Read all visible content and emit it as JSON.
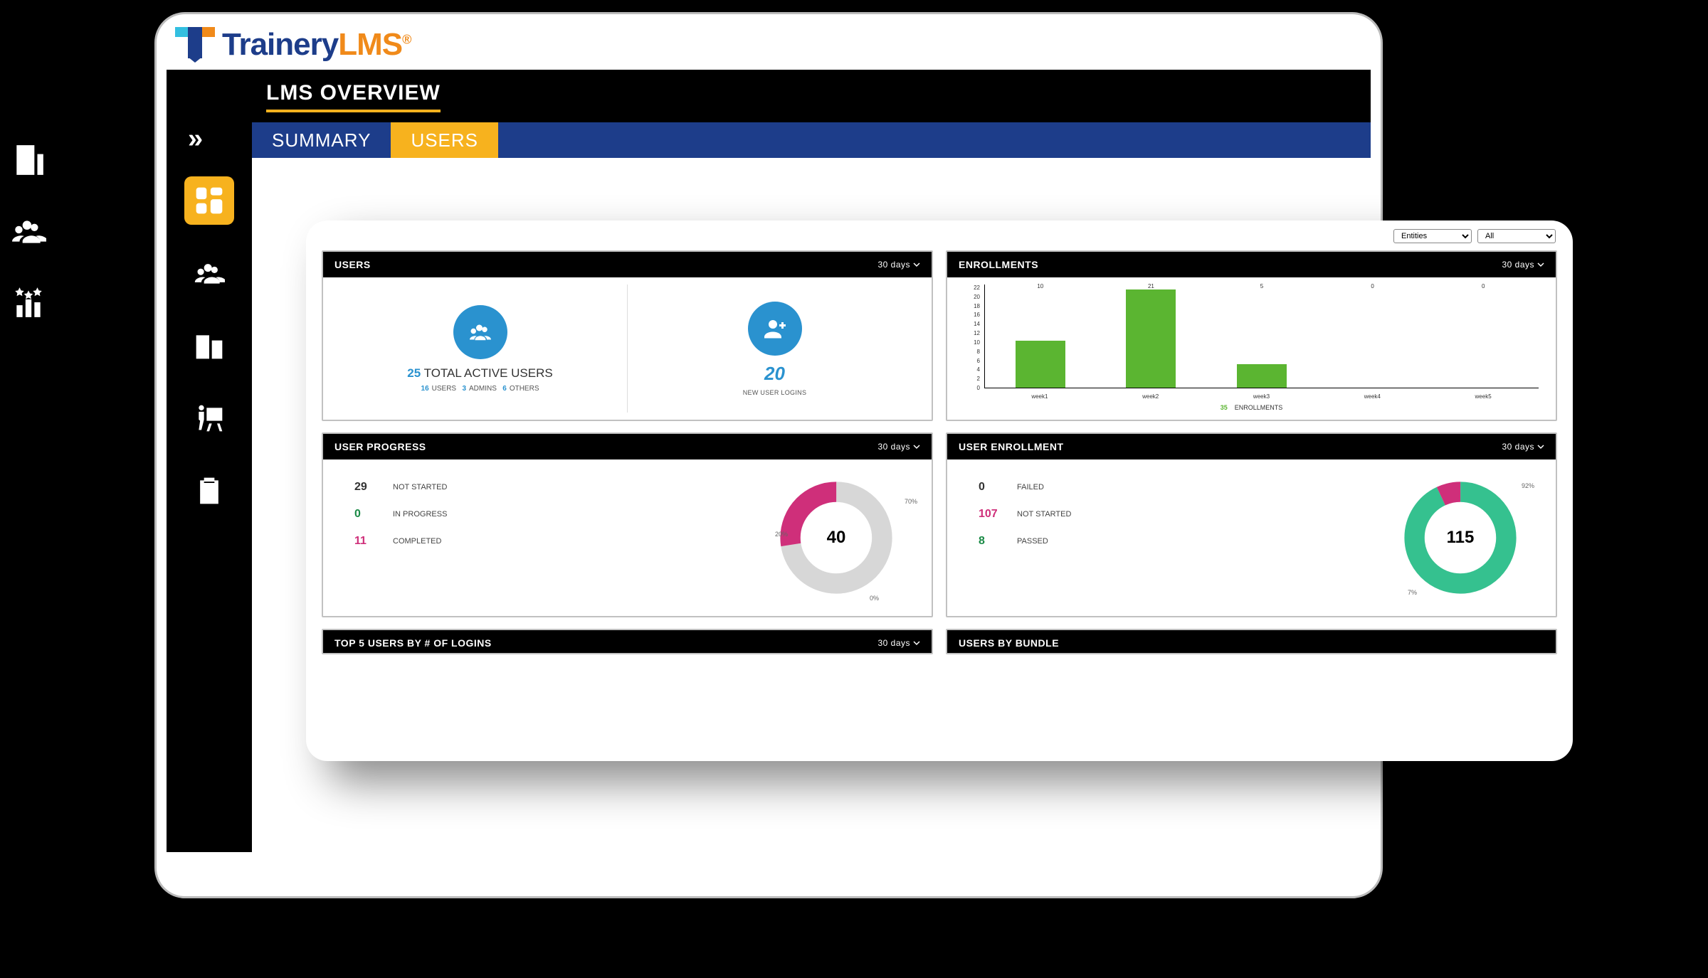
{
  "brand": {
    "text1": "Trainery",
    "text2": "LMS",
    "reg": "®"
  },
  "page_title": "LMS OVERVIEW",
  "tabs": {
    "summary": "SUMMARY",
    "users": "USERS"
  },
  "filters": {
    "sel1": "Entities",
    "sel2": "All"
  },
  "range_label": "30 days",
  "cards": {
    "users": {
      "title": "USERS",
      "total_num": "25",
      "total_label": " TOTAL ACTIVE USERS",
      "breakdown": {
        "users_n": "16",
        "users_l": "USERS",
        "admins_n": "3",
        "admins_l": "ADMINS",
        "others_n": "6",
        "others_l": "OTHERS"
      },
      "new_logins_n": "20",
      "new_logins_l": "NEW USER LOGINS"
    },
    "enrollments": {
      "title": "ENROLLMENTS",
      "total_n": "35",
      "total_l": "ENROLLMENTS"
    },
    "user_progress": {
      "title": "USER PROGRESS",
      "rows": {
        "not_started_n": "29",
        "not_started_l": "NOT STARTED",
        "in_progress_n": "0",
        "in_progress_l": "IN PROGRESS",
        "completed_n": "11",
        "completed_l": "COMPLETED"
      },
      "center": "40",
      "label_a": "70%",
      "label_b": "20%",
      "label_c": "0%"
    },
    "user_enrollment": {
      "title": "USER ENROLLMENT",
      "rows": {
        "failed_n": "0",
        "failed_l": "FAILED",
        "not_started_n": "107",
        "not_started_l": "NOT STARTED",
        "passed_n": "8",
        "passed_l": "PASSED"
      },
      "center": "115",
      "label_a": "92%",
      "label_b": "7%"
    },
    "top5": {
      "title": "TOP 5 USERS BY # OF LOGINS"
    },
    "by_bundle": {
      "title": "USERS BY BUNDLE"
    }
  },
  "chart_data": {
    "type": "bar",
    "title": "ENROLLMENTS",
    "xlabel": "",
    "ylabel": "",
    "ylim": [
      0,
      22
    ],
    "yticks": [
      0,
      2,
      4,
      6,
      8,
      10,
      12,
      14,
      16,
      18,
      20,
      22
    ],
    "categories": [
      "week1",
      "week2",
      "week3",
      "week4",
      "week5"
    ],
    "values": [
      10,
      21,
      5,
      0,
      0
    ],
    "total": 35
  },
  "donut_progress": {
    "type": "pie",
    "labels": [
      "NOT STARTED",
      "IN PROGRESS",
      "COMPLETED"
    ],
    "values": [
      29,
      0,
      11
    ],
    "colors": [
      "#d7d7d7",
      "#5bb531",
      "#cf2f7a"
    ],
    "center_total": 40
  },
  "donut_enrollment": {
    "type": "pie",
    "labels": [
      "FAILED",
      "NOT STARTED",
      "PASSED"
    ],
    "values": [
      0,
      107,
      8
    ],
    "colors": [
      "#d7d7d7",
      "#35c18f",
      "#cf2f7a"
    ],
    "center_total": 115
  }
}
